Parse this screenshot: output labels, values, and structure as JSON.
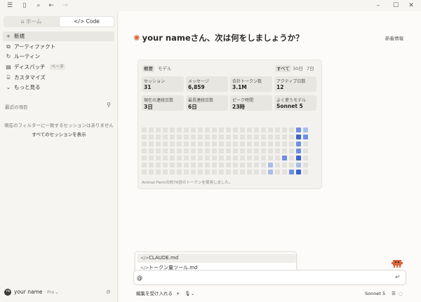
{
  "sidebar": {
    "mode_tabs": [
      {
        "icon": "home-icon",
        "label": "ホーム"
      },
      {
        "icon": "code-icon",
        "label": "Code"
      }
    ],
    "nav": [
      {
        "icon": "plus-icon",
        "label": "新規"
      },
      {
        "icon": "artifact-icon",
        "label": "アーティファクト"
      },
      {
        "icon": "routine-icon",
        "label": "ルーティン"
      },
      {
        "icon": "dispatch-icon",
        "label": "ディスパッチ",
        "badge": "ベータ"
      },
      {
        "icon": "customize-icon",
        "label": "カスタマイズ"
      },
      {
        "icon": "chevron-down-icon",
        "label": "もっと見る"
      }
    ],
    "recent_title": "最近の項目",
    "empty_message": "現在のフィルターに一致するセッションはありません",
    "show_all": "すべてのセッションを表示",
    "user": {
      "initials": "YN",
      "name": "your name",
      "plan": "· Pro"
    }
  },
  "main": {
    "greeting": "your nameさん、次は何をしましょうか？",
    "whats_new": "新着情報",
    "stats": {
      "tabs": [
        "概要",
        "モデル"
      ],
      "ranges": [
        "すべて",
        "30日",
        "7日"
      ],
      "tiles": [
        {
          "label": "セッション",
          "value": "31"
        },
        {
          "label": "メッセージ",
          "value": "6,859"
        },
        {
          "label": "合計トークン数",
          "value": "3.1M"
        },
        {
          "label": "アクティブ日数",
          "value": "12"
        },
        {
          "label": "現在の連続日数",
          "value": "3日"
        },
        {
          "label": "最長連続日数",
          "value": "6日"
        },
        {
          "label": "ピーク時間",
          "value": "23時"
        },
        {
          "label": "よく使うモデル",
          "value": "Sonnet 5"
        }
      ],
      "footnote": "Animal Farmの約76倍のトークンを使用しました。"
    },
    "mention": {
      "items": [
        {
          "icon": "code-icon",
          "label": "CLAUDE.md"
        },
        {
          "icon": "code-icon",
          "label": "トークン量ツール.md"
        }
      ]
    },
    "composer": {
      "value": "@"
    },
    "bottom": {
      "permission": "編集を受け入れる",
      "model": "Sonnet 5"
    }
  },
  "colors": {
    "accent": "#d9663a",
    "heat_light": "#a8bdea",
    "heat_mid": "#6f8ee0",
    "heat_dark": "#3a63d0",
    "heat_empty": "#e3e1dc"
  }
}
